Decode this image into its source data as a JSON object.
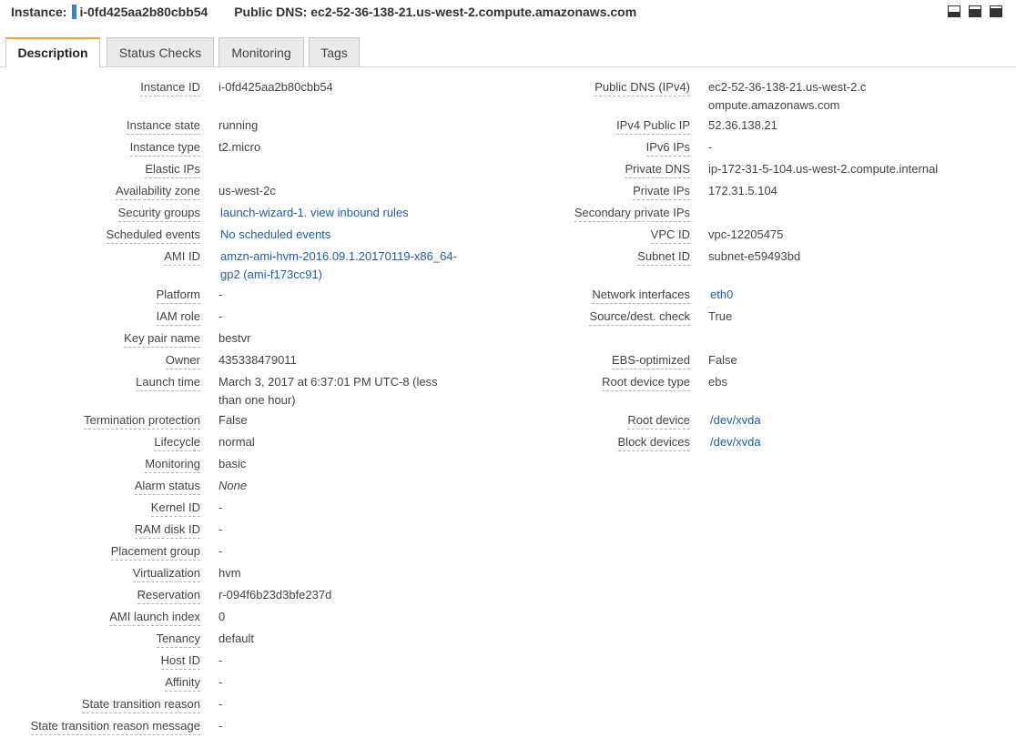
{
  "header": {
    "instance_label": "Instance:",
    "instance_id": "i-0fd425aa2b80cbb54",
    "dns_label": "Public DNS:",
    "dns_value": "ec2-52-36-138-21.us-west-2.compute.amazonaws.com"
  },
  "tabs": [
    "Description",
    "Status Checks",
    "Monitoring",
    "Tags"
  ],
  "left": [
    {
      "label": "Instance ID",
      "value": "i-0fd425aa2b80cbb54"
    },
    {
      "label": "Instance state",
      "value": "running"
    },
    {
      "label": "Instance type",
      "value": "t2.micro"
    },
    {
      "label": "Elastic IPs",
      "value": ""
    },
    {
      "label": "Availability zone",
      "value": "us-west-2c"
    },
    {
      "label": "Security groups",
      "value": "launch-wizard-1",
      "value2": ". ",
      "value3": "view inbound rules"
    },
    {
      "label": "Scheduled events",
      "value": "No scheduled events"
    },
    {
      "label": "AMI ID",
      "value": "amzn-ami-hvm-2016.09.1.20170119-x86_64-gp2 (ami-f173cc91)"
    },
    {
      "label": "Platform",
      "value": "-"
    },
    {
      "label": "IAM role",
      "value": "-"
    },
    {
      "label": "Key pair name",
      "value": "bestvr"
    },
    {
      "label": "Owner",
      "value": "435338479011"
    },
    {
      "label": "Launch time",
      "value": "March 3, 2017 at 6:37:01 PM UTC-8 (less than one hour)"
    },
    {
      "label": "Termination protection",
      "value": "False"
    },
    {
      "label": "Lifecycle",
      "value": "normal"
    },
    {
      "label": "Monitoring",
      "value": "basic"
    },
    {
      "label": "Alarm status",
      "value": "None"
    },
    {
      "label": "Kernel ID",
      "value": "-"
    },
    {
      "label": "RAM disk ID",
      "value": "-"
    },
    {
      "label": "Placement group",
      "value": "-"
    },
    {
      "label": "Virtualization",
      "value": "hvm"
    },
    {
      "label": "Reservation",
      "value": "r-094f6b23d3bfe237d"
    },
    {
      "label": "AMI launch index",
      "value": "0"
    },
    {
      "label": "Tenancy",
      "value": "default"
    },
    {
      "label": "Host ID",
      "value": "-"
    },
    {
      "label": "Affinity",
      "value": "-"
    },
    {
      "label": "State transition reason",
      "value": "-"
    },
    {
      "label": "State transition reason message",
      "value": "-"
    }
  ],
  "right": [
    {
      "label": "Public DNS (IPv4)",
      "value": "ec2-52-36-138-21.us-west-2.compute.amazonaws.com"
    },
    {
      "label": "IPv4 Public IP",
      "value": "52.36.138.21"
    },
    {
      "label": "IPv6 IPs",
      "value": "-"
    },
    {
      "label": "Private DNS",
      "value": "ip-172-31-5-104.us-west-2.compute.internal"
    },
    {
      "label": "Private IPs",
      "value": "172.31.5.104"
    },
    {
      "label": "Secondary private IPs",
      "value": ""
    },
    {
      "label": "VPC ID",
      "value": "vpc-12205475"
    },
    {
      "label": "Subnet ID",
      "value": "subnet-e59493bd"
    },
    {
      "label": "Network interfaces",
      "value": "eth0"
    },
    {
      "label": "Source/dest. check",
      "value": "True"
    },
    {
      "label": "EBS-optimized",
      "value": "False"
    },
    {
      "label": "Root device type",
      "value": "ebs"
    },
    {
      "label": "Root device",
      "value": "/dev/xvda"
    },
    {
      "label": "Block devices",
      "value": "/dev/xvda"
    }
  ]
}
